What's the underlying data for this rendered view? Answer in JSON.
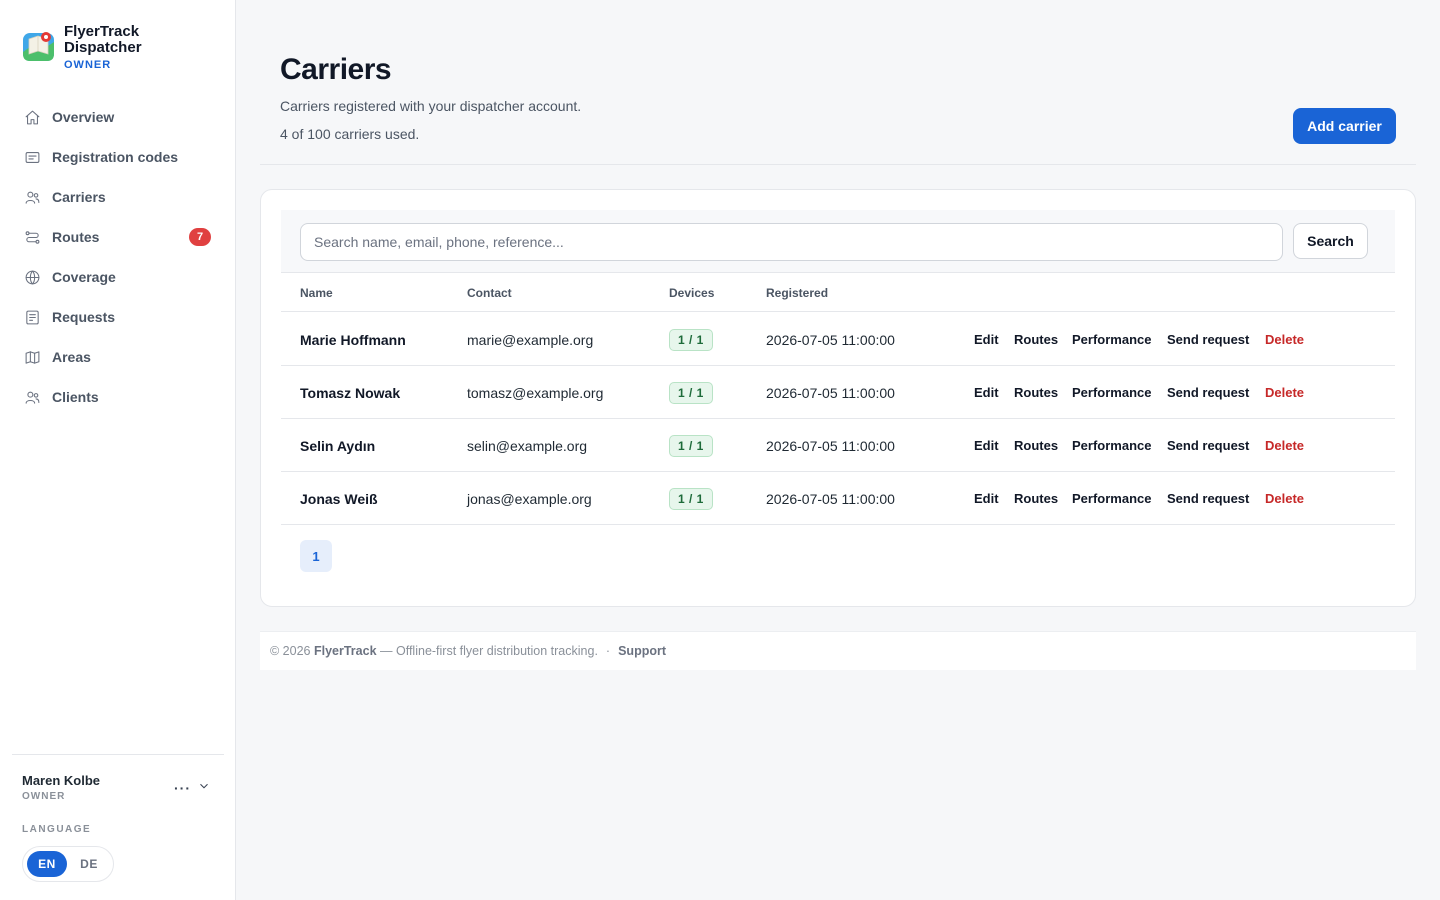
{
  "brand": {
    "name": "FlyerTrack Dispatcher",
    "role": "OWNER",
    "logo_icon": "map-pin-logo-icon"
  },
  "nav": [
    {
      "label": "Overview",
      "icon": "home-icon"
    },
    {
      "label": "Registration codes",
      "icon": "id-card-icon"
    },
    {
      "label": "Carriers",
      "icon": "users-icon"
    },
    {
      "label": "Routes",
      "icon": "route-icon",
      "badge": "7"
    },
    {
      "label": "Coverage",
      "icon": "globe-icon"
    },
    {
      "label": "Requests",
      "icon": "document-icon"
    },
    {
      "label": "Areas",
      "icon": "map-icon"
    },
    {
      "label": "Clients",
      "icon": "users-icon"
    }
  ],
  "user": {
    "name": "Maren Kolbe",
    "role": "OWNER",
    "menu_dots": "···"
  },
  "language": {
    "label": "LANGUAGE",
    "options": [
      "EN",
      "DE"
    ],
    "active": "EN"
  },
  "header": {
    "title": "Carriers",
    "subtitle": "Carriers registered with your dispatcher account.",
    "count": "4 of 100 carriers used.",
    "add_label": "Add carrier"
  },
  "search": {
    "placeholder": "Search name, email, phone, reference...",
    "button": "Search"
  },
  "table": {
    "columns": [
      "Name",
      "Contact",
      "Devices",
      "Registered"
    ],
    "actions": [
      "Edit",
      "Routes",
      "Performance",
      "Send request",
      "Delete"
    ],
    "rows": [
      {
        "name": "Marie Hoffmann",
        "contact": "marie@example.org",
        "devices": "1 / 1",
        "registered": "2026-07-05 11:00:00"
      },
      {
        "name": "Tomasz Nowak",
        "contact": "tomasz@example.org",
        "devices": "1 / 1",
        "registered": "2026-07-05 11:00:00"
      },
      {
        "name": "Selin Aydın",
        "contact": "selin@example.org",
        "devices": "1 / 1",
        "registered": "2026-07-05 11:00:00"
      },
      {
        "name": "Jonas Weiß",
        "contact": "jonas@example.org",
        "devices": "1 / 1",
        "registered": "2026-07-05 11:00:00"
      }
    ]
  },
  "pagination": {
    "current": "1"
  },
  "footer": {
    "copyright": "© 2026",
    "brand": "FlyerTrack",
    "tagline": "— Offline-first flyer distribution tracking.",
    "separator": "·",
    "support": "Support"
  },
  "colors": {
    "accent": "#1a64d6",
    "danger": "#c62828",
    "badge": "#e04040",
    "device_badge_bg": "#e7f6ec"
  }
}
